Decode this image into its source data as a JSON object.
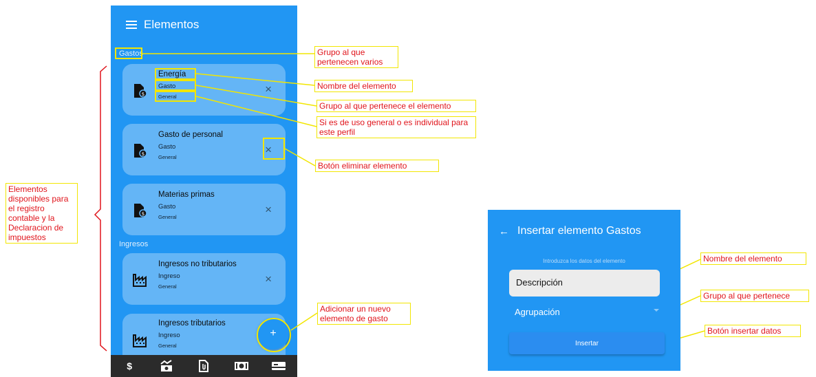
{
  "screen1": {
    "title": "Elementos",
    "sections": [
      {
        "label": "Gastos",
        "items": [
          {
            "name": "Energía",
            "group": "Gasto",
            "scope": "General",
            "icon": "invoice-icon"
          },
          {
            "name": "Gasto de personal",
            "group": "Gasto",
            "scope": "General",
            "icon": "invoice-icon"
          },
          {
            "name": "Materias primas",
            "group": "Gasto",
            "scope": "General",
            "icon": "invoice-icon"
          }
        ]
      },
      {
        "label": "Ingresos",
        "items": [
          {
            "name": "Ingresos no tributarios",
            "group": "Ingreso",
            "scope": "General",
            "icon": "factory-icon"
          },
          {
            "name": "Ingresos tributarios",
            "group": "Ingreso",
            "scope": "General",
            "icon": "factory-icon"
          }
        ]
      }
    ],
    "delete_glyph": "×",
    "fab_label": "+",
    "bottom_nav": [
      {
        "glyph": "$",
        "icon": "dollar-icon"
      },
      {
        "glyph": "",
        "icon": "chart-money-icon"
      },
      {
        "glyph": "",
        "icon": "document-icon"
      },
      {
        "glyph": "",
        "icon": "cash-icon"
      },
      {
        "glyph": "",
        "icon": "card-icon"
      }
    ]
  },
  "screen2": {
    "title": "Insertar elemento Gastos",
    "back_glyph": "←",
    "hint": "Introduzca los datos del elemento",
    "description_placeholder": "Descripción",
    "grouping_select": "Agrupación",
    "insert_button": "Insertar"
  },
  "annotations": {
    "group_various": "Grupo al que pertenecen varios",
    "element_name": "Nombre del elemento",
    "element_group": "Grupo al que pertenece el elemento",
    "general_or_individual": "Si es de uso general o es individual para este perfil",
    "delete_button": "Botón eliminar elemento",
    "available_elements": "Elementos disponibles para el registro contable y la Declaracion de impuestos",
    "add_new": "Adicionar un nuevo elemento de gasto",
    "name_field": "Nombre del elemento",
    "group_field": "Grupo al que pertenece",
    "insert_button": "Botón insertar datos"
  },
  "colors": {
    "primary": "#2196f3",
    "card": "#64b5f6",
    "annotation_border": "#f2e600",
    "annotation_text": "#e0141b",
    "bracket": "#e0141b"
  }
}
